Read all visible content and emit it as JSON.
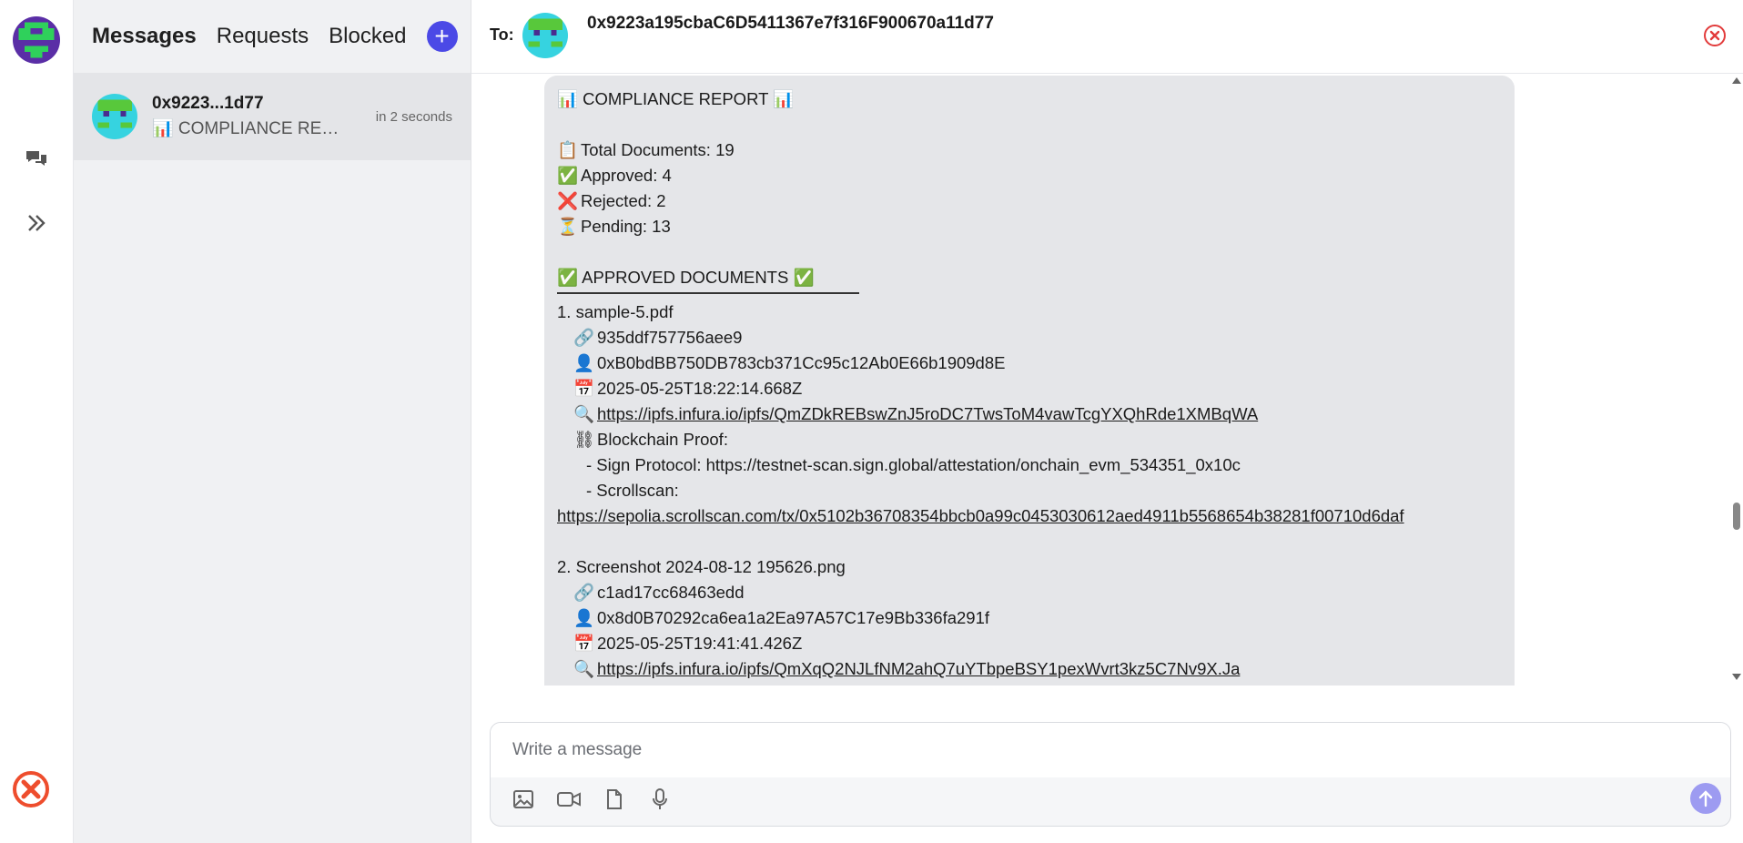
{
  "tabs": {
    "messages": "Messages",
    "requests": "Requests",
    "blocked": "Blocked",
    "plus": "+"
  },
  "conversation": {
    "name": "0x9223...1d77",
    "preview": "📊 COMPLIANCE REPORT 📊",
    "time": "in 2 seconds"
  },
  "header": {
    "to_label": "To:",
    "address": "0x9223a195cbaC6D5411367e7f316F900670a11d77"
  },
  "message": {
    "title": "📊 COMPLIANCE REPORT 📊",
    "stats": [
      {
        "emoji": "📋",
        "text": "Total Documents: 19"
      },
      {
        "emoji": "✅",
        "text": "Approved: 4"
      },
      {
        "emoji": "❌",
        "text": "Rejected: 2"
      },
      {
        "emoji": "⏳",
        "text": "Pending: 13"
      }
    ],
    "approved_heading": "✅ APPROVED DOCUMENTS ✅",
    "doc1": {
      "title": "1. sample-5.pdf",
      "hash": "935ddf757756aee9",
      "owner": "0xB0bdBB750DB783cb371Cc95c12Ab0E66b1909d8E",
      "date": "2025-05-25T18:22:14.668Z",
      "ipfs": "https://ipfs.infura.io/ipfs/QmZDkREBswZnJ5roDC7TwsToM4vawTcgYXQhRde1XMBqWA",
      "proof_label": "Blockchain Proof:",
      "sign_protocol": "- Sign Protocol: https://testnet-scan.sign.global/attestation/onchain_evm_534351_0x10c",
      "scrollscan_label": "- Scrollscan:",
      "scrollscan_url": "https://sepolia.scrollscan.com/tx/0x5102b36708354bbcb0a99c0453030612aed4911b5568654b38281f00710d6daf"
    },
    "doc2": {
      "title": "2. Screenshot 2024-08-12 195626.png",
      "hash": "c1ad17cc68463edd",
      "owner": "0x8d0B70292ca6ea1a2Ea97A57C17e9Bb336fa291f",
      "date": "2025-05-25T19:41:41.426Z",
      "ipfs": "https://ipfs.infura.io/ipfs/QmXqQ2NJLfNM2ahQ7uYTbpeBSY1pexWvrt3kz5C7Nv9X.Ja"
    }
  },
  "composer": {
    "placeholder": "Write a message"
  },
  "colors": {
    "accent": "#4b49e6",
    "send_button": "#9d9bf1",
    "close": "#e23b3b",
    "brand_logo": "#ee4d2d"
  }
}
